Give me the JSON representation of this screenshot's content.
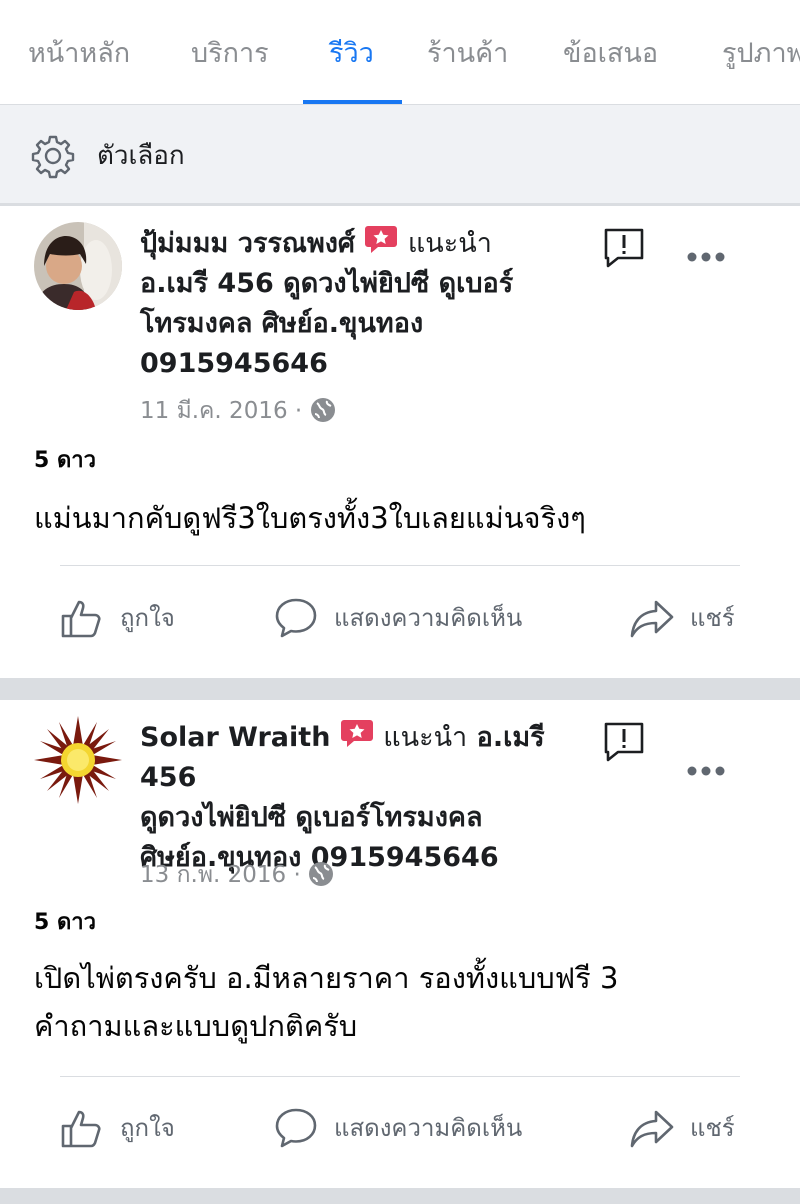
{
  "tabs": [
    {
      "label": "หน้าหลัก",
      "active": false
    },
    {
      "label": "บริการ",
      "active": false
    },
    {
      "label": "รีวิว",
      "active": true
    },
    {
      "label": "ร้านค้า",
      "active": false
    },
    {
      "label": "ข้อเสนอ",
      "active": false
    },
    {
      "label": "รูปภาพ",
      "active": false
    }
  ],
  "options": {
    "label": "ตัวเลือก",
    "icon": "gear-icon"
  },
  "reviews": [
    {
      "author": "ปุ้ม่มมม วรรณพงศ์",
      "recommends": "แนะนำ",
      "page_line1": "อ.เมรี 456 ดูดวงไพ่ยิปซี ดูเบอร์",
      "page_line2": "โทรมงคล ศิษย์อ.ขุนทอง",
      "page_line3": "0915945646",
      "date": "11 มี.ค. 2016 ·",
      "rating": "5 ดาว",
      "text_line1": "แม่นมากคับดูฟรี3ใบตรงทั้ง3ใบเลยแม่นจริงๆ",
      "text_line2": ""
    },
    {
      "author": "Solar Wraith",
      "recommends": "แนะนำ",
      "page_line1": "อ.เมรี 456",
      "page_line2": "ดูดวงไพ่ยิปซี ดูเบอร์โทรมงคล",
      "page_line3": "ศิษย์อ.ขุนทอง 0915945646",
      "date": "13 ก.พ. 2016 ·",
      "rating": "5 ดาว",
      "text_line1": "เปิดไพ่ตรงครับ อ.มีหลายราคา รองทั้งแบบฟรี 3",
      "text_line2": "คำถามและแบบดูปกติครับ"
    }
  ],
  "actions": {
    "like": "ถูกใจ",
    "comment": "แสดงความคิดเห็น",
    "share": "แชร์"
  },
  "colors": {
    "accent": "#1877f2",
    "badge": "#e4405f",
    "muted": "#8a8d91"
  }
}
